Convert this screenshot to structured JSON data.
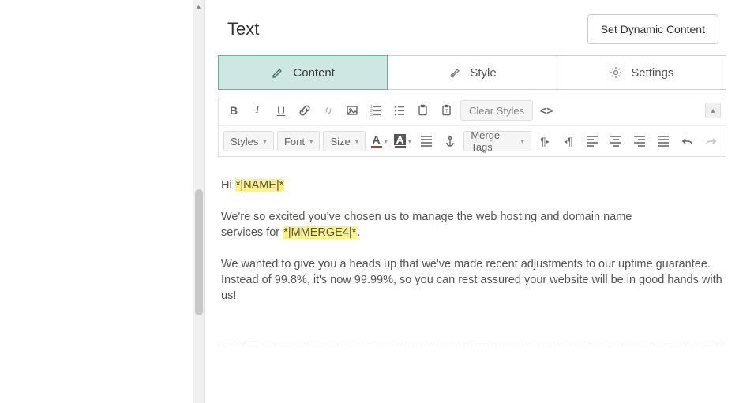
{
  "header": {
    "title": "Text",
    "dynamic_button": "Set Dynamic Content"
  },
  "tabs": {
    "content": "Content",
    "style": "Style",
    "settings": "Settings"
  },
  "toolbar": {
    "clear_styles": "Clear Styles",
    "dropdowns": {
      "styles": "Styles",
      "font": "Font",
      "size": "Size",
      "merge_tags": "Merge Tags"
    }
  },
  "body": {
    "greeting_prefix": "Hi ",
    "greeting_merge": "*|NAME|*",
    "p1_prefix": "We're so excited you've chosen us to manage the web hosting and domain name services for ",
    "p1_merge": "*|MMERGE4|*",
    "p1_suffix": ".",
    "p2": "We wanted to give you a heads up that we've made recent adjustments to our uptime guarantee. Instead of 99.8%, it's now 99.99%, so you can rest assured your website will be in good hands with us!"
  }
}
